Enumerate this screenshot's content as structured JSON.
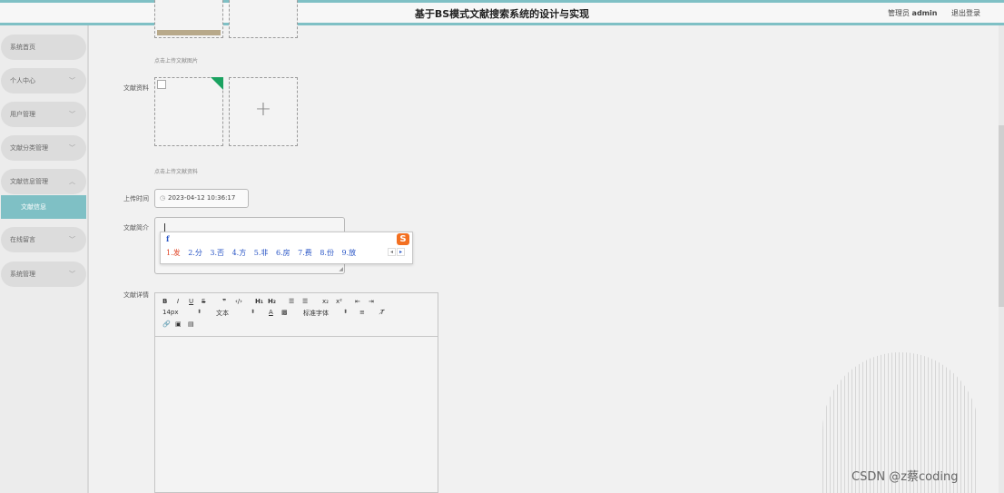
{
  "header": {
    "title": "基于BS模式文献搜索系统的设计与实现",
    "admin_label": "管理员",
    "admin_name": "admin",
    "logout": "退出登录"
  },
  "sidebar": {
    "items": [
      {
        "label": "系统首页"
      },
      {
        "label": "个人中心"
      },
      {
        "label": "用户管理"
      },
      {
        "label": "文献分类管理"
      },
      {
        "label": "文献信息管理"
      },
      {
        "label": "在线留言"
      },
      {
        "label": "系统管理"
      }
    ],
    "sub_item": "文献信息"
  },
  "form": {
    "image_hint": "点击上传文献图片",
    "material_label": "文献资料",
    "material_hint": "点击上传文献资料",
    "upload_time_label": "上传时间",
    "upload_time_value": "2023-04-12 10:36:17",
    "intro_label": "文献简介",
    "detail_label": "文献详情"
  },
  "ime": {
    "input": "f",
    "candidates": [
      "1.发",
      "2.分",
      "3.否",
      "4.方",
      "5.非",
      "6.房",
      "7.费",
      "8.份",
      "9.放"
    ],
    "logo": "S"
  },
  "editor": {
    "font_size": "14px",
    "text_style": "文本",
    "font_family": "标准字体"
  },
  "watermark": "CSDN @z蔡coding",
  "colors": {
    "accent": "#7fc0c5",
    "ime_blue": "#2a56c6",
    "ime_first": "#e0492b",
    "tag_green": "#1aa260"
  }
}
